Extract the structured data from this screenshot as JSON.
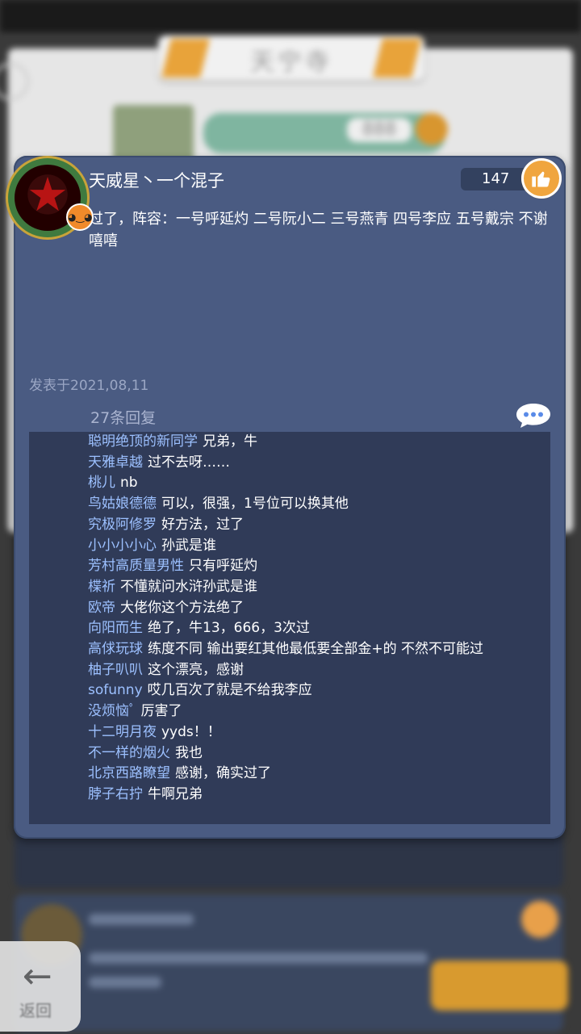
{
  "background": {
    "title": "天宁寺",
    "score": "888",
    "back_label": "返回"
  },
  "post": {
    "username": "天威星丶一个混子",
    "likes": "147",
    "content": "过了，阵容：一号呼延灼 二号阮小二 三号燕青 四号李应 五号戴宗 不谢嘻嘻",
    "date": "发表于2021,08,11",
    "reply_count": "27条回复",
    "replies": [
      {
        "nick": "聪明绝顶的新同学",
        "text": "兄弟，牛"
      },
      {
        "nick": "天雅卓越",
        "text": "过不去呀……"
      },
      {
        "nick": "桃儿",
        "text": "nb"
      },
      {
        "nick": "鸟姑娘德德",
        "text": "可以，很强，1号位可以换其他"
      },
      {
        "nick": "究极阿修罗",
        "text": "好方法，过了"
      },
      {
        "nick": "小小小小心",
        "text": "孙武是谁"
      },
      {
        "nick": "芳村高质量男性",
        "text": "只有呼延灼"
      },
      {
        "nick": "楪祈",
        "text": "不懂就问水浒孙武是谁"
      },
      {
        "nick": "欧帝",
        "text": "大佬你这个方法绝了"
      },
      {
        "nick": "向阳而生",
        "text": "绝了，牛13，666，3次过"
      },
      {
        "nick": "高俅玩球",
        "text": "练度不同 输出要红其他最低要全部金+的 不然不可能过"
      },
      {
        "nick": "柚子叭叭",
        "text": "这个漂亮，感谢"
      },
      {
        "nick": "sofunny",
        "text": "哎几百次了就是不给我李应"
      },
      {
        "nick": "没烦恼ﾟ",
        "text": "厉害了"
      },
      {
        "nick": "十二明月夜",
        "text": "yyds！！"
      },
      {
        "nick": "不一样的烟火",
        "text": "我也"
      },
      {
        "nick": "北京西路瞭望",
        "text": "感谢，确实过了"
      },
      {
        "nick": "脖子右拧",
        "text": "牛啊兄弟"
      }
    ]
  },
  "colors": {
    "card": "#4a5b82",
    "reply_panel": "#303b58",
    "nick": "#9cc0ff",
    "like_button": "#f0a53e"
  },
  "icons": {
    "like": "thumbs-up-icon",
    "chat": "chat-bubble-icon",
    "back": "arrow-left-icon"
  }
}
